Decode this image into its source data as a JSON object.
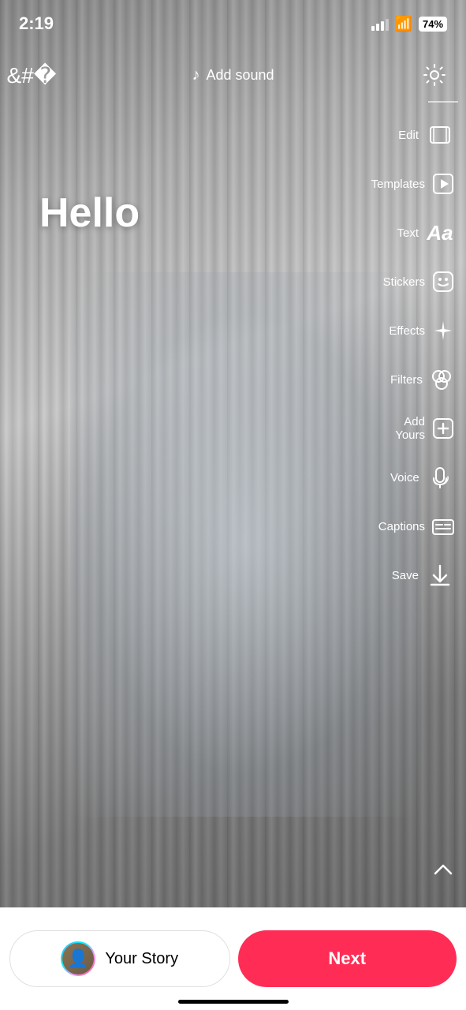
{
  "statusBar": {
    "time": "2:19",
    "battery": "74"
  },
  "topControls": {
    "addSoundLabel": "Add sound",
    "settingsAriaLabel": "Settings"
  },
  "mainContent": {
    "overlayText": "Hello"
  },
  "rightMenu": {
    "items": [
      {
        "id": "edit",
        "label": "Edit",
        "icon": "edit"
      },
      {
        "id": "templates",
        "label": "Templates",
        "icon": "templates"
      },
      {
        "id": "text",
        "label": "Text",
        "icon": "text"
      },
      {
        "id": "stickers",
        "label": "Stickers",
        "icon": "stickers"
      },
      {
        "id": "effects",
        "label": "Effects",
        "icon": "effects"
      },
      {
        "id": "filters",
        "label": "Filters",
        "icon": "filters"
      },
      {
        "id": "add-yours",
        "label": "Add Yours",
        "icon": "add-yours"
      },
      {
        "id": "voice",
        "label": "Voice",
        "icon": "voice"
      },
      {
        "id": "captions",
        "label": "Captions",
        "icon": "captions"
      },
      {
        "id": "save",
        "label": "Save",
        "icon": "save"
      }
    ]
  },
  "bottomBar": {
    "yourStoryLabel": "Your Story",
    "nextLabel": "Next"
  }
}
